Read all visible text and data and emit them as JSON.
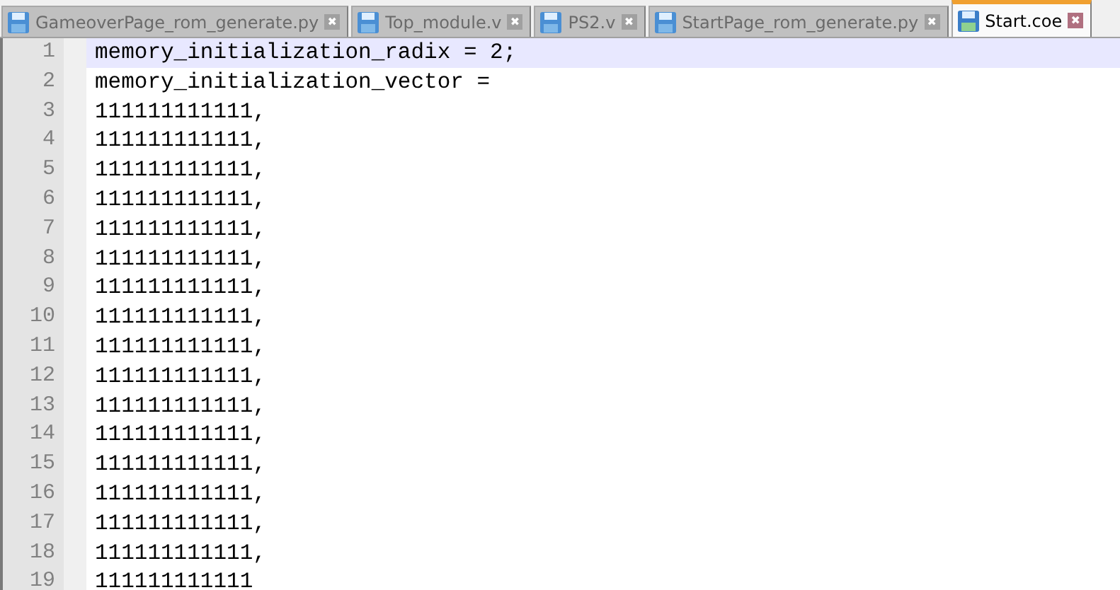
{
  "tabs": [
    {
      "label": "GameoverPage_rom_generate.py",
      "selected": false
    },
    {
      "label": "Top_module.v",
      "selected": false
    },
    {
      "label": "PS2.v",
      "selected": false
    },
    {
      "label": "StartPage_rom_generate.py",
      "selected": false
    },
    {
      "label": "Start.coe",
      "selected": true
    }
  ],
  "close_glyph": "✖",
  "lines": [
    {
      "number": "1",
      "text": "memory_initialization_radix = 2;",
      "current": true
    },
    {
      "number": "2",
      "text": "memory_initialization_vector =",
      "current": false
    },
    {
      "number": "3",
      "text": "111111111111,",
      "current": false
    },
    {
      "number": "4",
      "text": "111111111111,",
      "current": false
    },
    {
      "number": "5",
      "text": "111111111111,",
      "current": false
    },
    {
      "number": "6",
      "text": "111111111111,",
      "current": false
    },
    {
      "number": "7",
      "text": "111111111111,",
      "current": false
    },
    {
      "number": "8",
      "text": "111111111111,",
      "current": false
    },
    {
      "number": "9",
      "text": "111111111111,",
      "current": false
    },
    {
      "number": "10",
      "text": "111111111111,",
      "current": false
    },
    {
      "number": "11",
      "text": "111111111111,",
      "current": false
    },
    {
      "number": "12",
      "text": "111111111111,",
      "current": false
    },
    {
      "number": "13",
      "text": "111111111111,",
      "current": false
    },
    {
      "number": "14",
      "text": "111111111111,",
      "current": false
    },
    {
      "number": "15",
      "text": "111111111111,",
      "current": false
    },
    {
      "number": "16",
      "text": "111111111111,",
      "current": false
    },
    {
      "number": "17",
      "text": "111111111111,",
      "current": false
    },
    {
      "number": "18",
      "text": "111111111111,",
      "current": false
    },
    {
      "number": "19",
      "text": "111111111111",
      "current": false
    }
  ]
}
